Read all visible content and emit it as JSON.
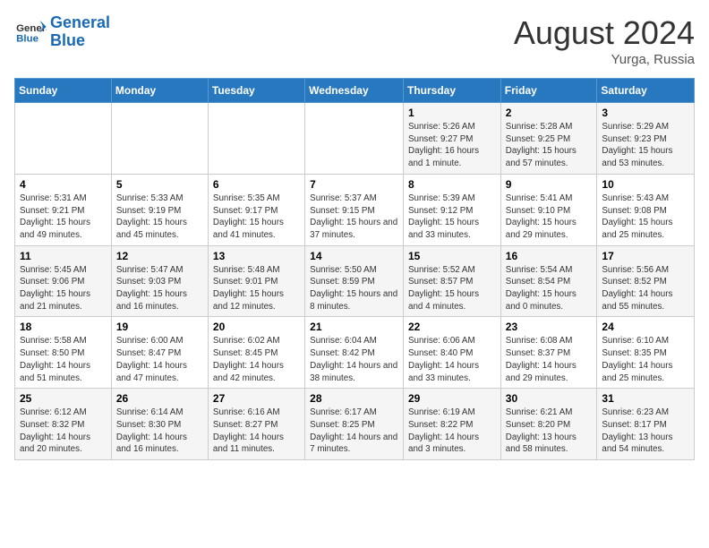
{
  "header": {
    "logo_line1": "General",
    "logo_line2": "Blue",
    "month_year": "August 2024",
    "location": "Yurga, Russia"
  },
  "days_of_week": [
    "Sunday",
    "Monday",
    "Tuesday",
    "Wednesday",
    "Thursday",
    "Friday",
    "Saturday"
  ],
  "weeks": [
    [
      {
        "day": "",
        "content": ""
      },
      {
        "day": "",
        "content": ""
      },
      {
        "day": "",
        "content": ""
      },
      {
        "day": "",
        "content": ""
      },
      {
        "day": "1",
        "content": "Sunrise: 5:26 AM\nSunset: 9:27 PM\nDaylight: 16 hours and 1 minute."
      },
      {
        "day": "2",
        "content": "Sunrise: 5:28 AM\nSunset: 9:25 PM\nDaylight: 15 hours and 57 minutes."
      },
      {
        "day": "3",
        "content": "Sunrise: 5:29 AM\nSunset: 9:23 PM\nDaylight: 15 hours and 53 minutes."
      }
    ],
    [
      {
        "day": "4",
        "content": "Sunrise: 5:31 AM\nSunset: 9:21 PM\nDaylight: 15 hours and 49 minutes."
      },
      {
        "day": "5",
        "content": "Sunrise: 5:33 AM\nSunset: 9:19 PM\nDaylight: 15 hours and 45 minutes."
      },
      {
        "day": "6",
        "content": "Sunrise: 5:35 AM\nSunset: 9:17 PM\nDaylight: 15 hours and 41 minutes."
      },
      {
        "day": "7",
        "content": "Sunrise: 5:37 AM\nSunset: 9:15 PM\nDaylight: 15 hours and 37 minutes."
      },
      {
        "day": "8",
        "content": "Sunrise: 5:39 AM\nSunset: 9:12 PM\nDaylight: 15 hours and 33 minutes."
      },
      {
        "day": "9",
        "content": "Sunrise: 5:41 AM\nSunset: 9:10 PM\nDaylight: 15 hours and 29 minutes."
      },
      {
        "day": "10",
        "content": "Sunrise: 5:43 AM\nSunset: 9:08 PM\nDaylight: 15 hours and 25 minutes."
      }
    ],
    [
      {
        "day": "11",
        "content": "Sunrise: 5:45 AM\nSunset: 9:06 PM\nDaylight: 15 hours and 21 minutes."
      },
      {
        "day": "12",
        "content": "Sunrise: 5:47 AM\nSunset: 9:03 PM\nDaylight: 15 hours and 16 minutes."
      },
      {
        "day": "13",
        "content": "Sunrise: 5:48 AM\nSunset: 9:01 PM\nDaylight: 15 hours and 12 minutes."
      },
      {
        "day": "14",
        "content": "Sunrise: 5:50 AM\nSunset: 8:59 PM\nDaylight: 15 hours and 8 minutes."
      },
      {
        "day": "15",
        "content": "Sunrise: 5:52 AM\nSunset: 8:57 PM\nDaylight: 15 hours and 4 minutes."
      },
      {
        "day": "16",
        "content": "Sunrise: 5:54 AM\nSunset: 8:54 PM\nDaylight: 15 hours and 0 minutes."
      },
      {
        "day": "17",
        "content": "Sunrise: 5:56 AM\nSunset: 8:52 PM\nDaylight: 14 hours and 55 minutes."
      }
    ],
    [
      {
        "day": "18",
        "content": "Sunrise: 5:58 AM\nSunset: 8:50 PM\nDaylight: 14 hours and 51 minutes."
      },
      {
        "day": "19",
        "content": "Sunrise: 6:00 AM\nSunset: 8:47 PM\nDaylight: 14 hours and 47 minutes."
      },
      {
        "day": "20",
        "content": "Sunrise: 6:02 AM\nSunset: 8:45 PM\nDaylight: 14 hours and 42 minutes."
      },
      {
        "day": "21",
        "content": "Sunrise: 6:04 AM\nSunset: 8:42 PM\nDaylight: 14 hours and 38 minutes."
      },
      {
        "day": "22",
        "content": "Sunrise: 6:06 AM\nSunset: 8:40 PM\nDaylight: 14 hours and 33 minutes."
      },
      {
        "day": "23",
        "content": "Sunrise: 6:08 AM\nSunset: 8:37 PM\nDaylight: 14 hours and 29 minutes."
      },
      {
        "day": "24",
        "content": "Sunrise: 6:10 AM\nSunset: 8:35 PM\nDaylight: 14 hours and 25 minutes."
      }
    ],
    [
      {
        "day": "25",
        "content": "Sunrise: 6:12 AM\nSunset: 8:32 PM\nDaylight: 14 hours and 20 minutes."
      },
      {
        "day": "26",
        "content": "Sunrise: 6:14 AM\nSunset: 8:30 PM\nDaylight: 14 hours and 16 minutes."
      },
      {
        "day": "27",
        "content": "Sunrise: 6:16 AM\nSunset: 8:27 PM\nDaylight: 14 hours and 11 minutes."
      },
      {
        "day": "28",
        "content": "Sunrise: 6:17 AM\nSunset: 8:25 PM\nDaylight: 14 hours and 7 minutes."
      },
      {
        "day": "29",
        "content": "Sunrise: 6:19 AM\nSunset: 8:22 PM\nDaylight: 14 hours and 3 minutes."
      },
      {
        "day": "30",
        "content": "Sunrise: 6:21 AM\nSunset: 8:20 PM\nDaylight: 13 hours and 58 minutes."
      },
      {
        "day": "31",
        "content": "Sunrise: 6:23 AM\nSunset: 8:17 PM\nDaylight: 13 hours and 54 minutes."
      }
    ]
  ]
}
